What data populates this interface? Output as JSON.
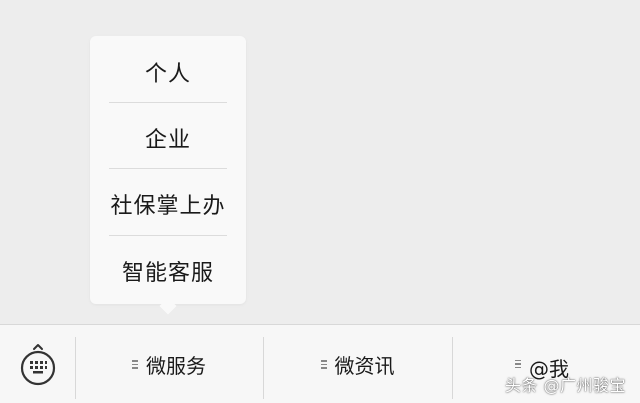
{
  "popup_menu": {
    "items": [
      {
        "label": "个人"
      },
      {
        "label": "企业"
      },
      {
        "label": "社保掌上办"
      },
      {
        "label": "智能客服"
      }
    ]
  },
  "bottom_bar": {
    "keyboard_icon": "keyboard-icon",
    "tabs": [
      {
        "label": "微服务",
        "icon": "menu-lines-icon"
      },
      {
        "label": "微资讯",
        "icon": "menu-lines-icon"
      },
      {
        "label": "@我",
        "icon": "menu-lines-icon"
      }
    ]
  },
  "watermark": {
    "text": "头条 @广州骏宝"
  }
}
